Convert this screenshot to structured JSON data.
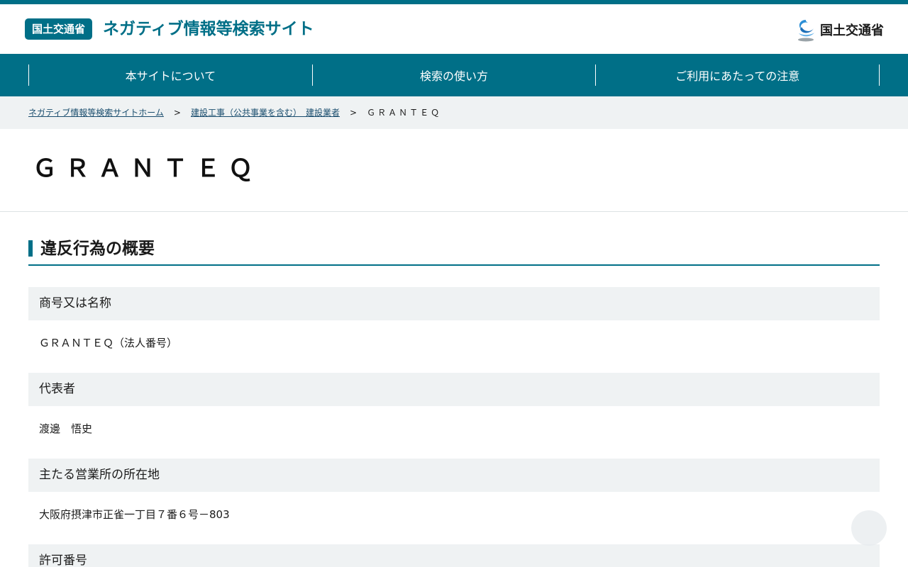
{
  "header": {
    "badge": "国土交通省",
    "title": "ネガティブ情報等検索サイト",
    "logo_text": "国土交通省",
    "brand_color": "#006f87"
  },
  "nav": {
    "items": [
      {
        "label": "本サイトについて"
      },
      {
        "label": "検索の使い方"
      },
      {
        "label": "ご利用にあたっての注意"
      }
    ]
  },
  "breadcrumb": {
    "home": "ネガティブ情報等検索サイトホーム",
    "category": "建設工事（公共事業を含む）　建設業者",
    "current": "ＧＲＡＮＴＥＱ",
    "separator": ">"
  },
  "page": {
    "title": "ＧＲＡＮＴＥＱ"
  },
  "section": {
    "heading": "違反行為の概要"
  },
  "fields": [
    {
      "label": "商号又は名称",
      "value": "ＧＲＡＮＴＥＱ（法人番号）"
    },
    {
      "label": "代表者",
      "value": "渡邊　悟史"
    },
    {
      "label": "主たる営業所の所在地",
      "value": "大阪府摂津市正雀一丁目７番６号－803"
    },
    {
      "label": "許可番号",
      "value": ""
    }
  ]
}
